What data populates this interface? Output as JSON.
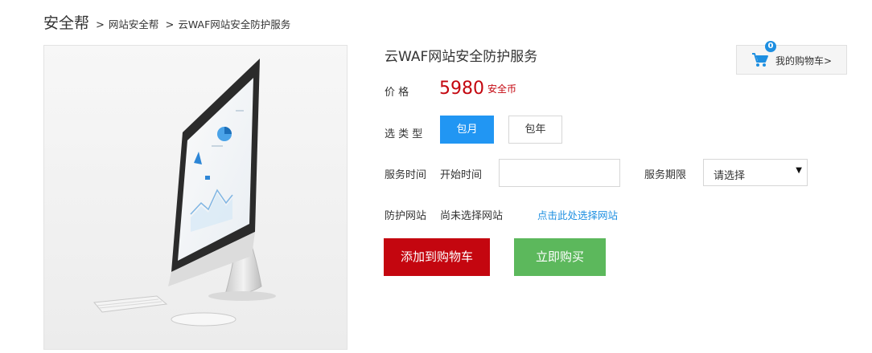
{
  "breadcrumb": {
    "home": "安全帮",
    "sep1": ">",
    "level1": "网站安全帮",
    "sep2": ">",
    "level2": "云WAF网站安全防护服务"
  },
  "product": {
    "title": "云WAF网站安全防护服务",
    "price_label": "价    格",
    "price_value": "5980",
    "price_unit": "安全币",
    "type_label": "选 类 型",
    "types": [
      {
        "label": "包月",
        "selected": true
      },
      {
        "label": "包年",
        "selected": false
      }
    ],
    "service_time_label": "服务时间",
    "start_time_label": "开始时间",
    "start_time_value": "",
    "period_label": "服务期限",
    "period_selected": "请选择",
    "site_label": "防护网站",
    "site_status": "尚未选择网站",
    "site_link": "点击此处选择网站"
  },
  "cart": {
    "count": "0",
    "label": "我的购物车>"
  },
  "actions": {
    "add_to_cart": "添加到购物车",
    "buy_now": "立即购买"
  },
  "colors": {
    "price_red": "#c4060f",
    "primary_blue": "#2196f3",
    "link_blue": "#1e8fe1",
    "buy_green": "#5cb85c"
  }
}
